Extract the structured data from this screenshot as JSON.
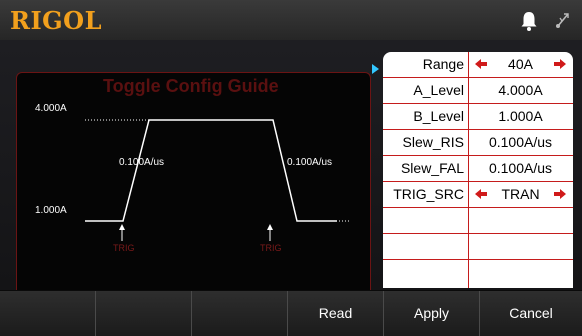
{
  "header": {
    "brand": "RIGOL",
    "icons": [
      "bell-icon",
      "usb-icon"
    ]
  },
  "guide": {
    "title": "Toggle Config Guide",
    "level_high": "4.000A",
    "level_low": "1.000A",
    "rise_rate": "0.100A/us",
    "fall_rate": "0.100A/us",
    "trig_label_1": "TRIG",
    "trig_label_2": "TRIG"
  },
  "params": [
    {
      "label": "Range",
      "value": "40A",
      "arrows": true
    },
    {
      "label": "A_Level",
      "value": "4.000A",
      "arrows": false
    },
    {
      "label": "B_Level",
      "value": "1.000A",
      "arrows": false
    },
    {
      "label": "Slew_RIS",
      "value": "0.100A/us",
      "arrows": false
    },
    {
      "label": "Slew_FAL",
      "value": "0.100A/us",
      "arrows": false
    },
    {
      "label": "TRIG_SRC",
      "value": "TRAN",
      "arrows": true
    },
    {
      "label": "",
      "value": "",
      "arrows": false
    },
    {
      "label": "",
      "value": "",
      "arrows": false
    },
    {
      "label": "",
      "value": "",
      "arrows": false
    }
  ],
  "softkeys": [
    "",
    "",
    "",
    "Read",
    "Apply",
    "Cancel"
  ],
  "colors": {
    "brand": "#f2a01d",
    "accent_red": "#c51c1c",
    "indicator": "#33c7ff"
  }
}
